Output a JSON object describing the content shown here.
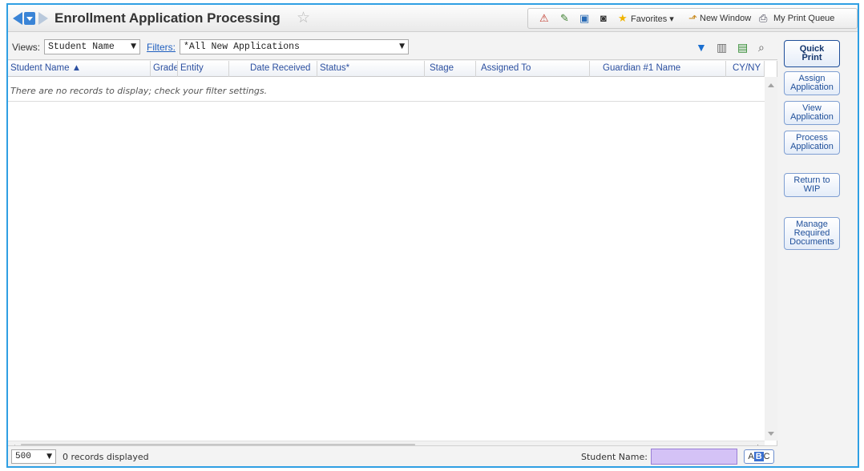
{
  "title": "Enrollment Application Processing",
  "toolbar": {
    "favorites_label": "Favorites",
    "new_window_label": "New Window",
    "print_queue_label": "My Print Queue"
  },
  "filters": {
    "views_label": "Views:",
    "view_value": "Student Name",
    "filters_label": "Filters:",
    "filter_value": "*All New Applications"
  },
  "grid": {
    "columns": [
      "Student Name ▲",
      "Grade",
      "Entity",
      "Date Received",
      "Status*",
      "Stage",
      "Assigned To",
      "Guardian #1 Name",
      "CY/NY"
    ],
    "empty_message": "There are no records to display; check your filter settings."
  },
  "footer": {
    "page_size": "500",
    "records_text": "0 records displayed",
    "search_label": "Student Name:",
    "search_value": "",
    "abc_a": "A",
    "abc_b": "B",
    "abc_c": "C"
  },
  "actions": {
    "quick_print": "Quick\nPrint",
    "assign": "Assign\nApplication",
    "view": "View\nApplication",
    "process": "Process\nApplication",
    "return_wip": "Return to\nWIP",
    "manage_docs": "Manage\nRequired\nDocuments"
  },
  "colors": {
    "frame_border": "#2f9fe3",
    "header_text": "#2b4fa0",
    "search_highlight": "#d4c2f6"
  }
}
